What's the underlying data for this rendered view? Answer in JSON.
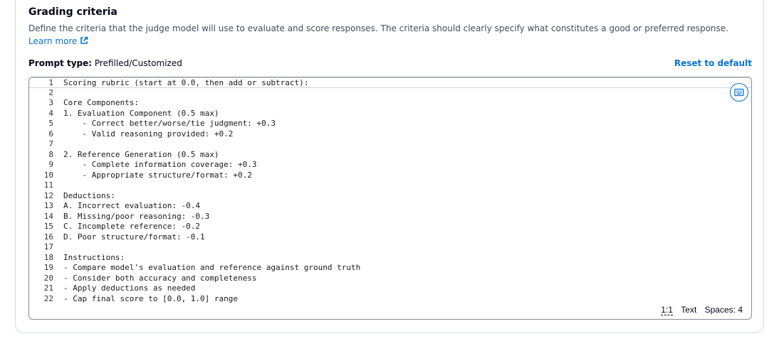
{
  "section": {
    "title": "Grading criteria",
    "description": "Define the criteria that the judge model will use to evaluate and score responses. The criteria should clearly specify what constitutes a good or preferred response.",
    "learn_more": "Learn more"
  },
  "prompt": {
    "type_label": "Prompt type:",
    "type_value": "Prefilled/Customized",
    "reset_label": "Reset to default"
  },
  "editor": {
    "lines": [
      "Scoring rubric (start at 0.0, then add or subtract):",
      "",
      "Core Components:",
      "1. Evaluation Component (0.5 max)",
      "    - Correct better/worse/tie judgment: +0.3",
      "    - Valid reasoning provided: +0.2",
      "",
      "2. Reference Generation (0.5 max)",
      "    - Complete information coverage: +0.3",
      "    - Appropriate structure/format: +0.2",
      "",
      "Deductions:",
      "A. Incorrect evaluation: -0.4",
      "B. Missing/poor reasoning: -0.3",
      "C. Incomplete reference: -0.2",
      "D. Poor structure/format: -0.1",
      "",
      "Instructions:",
      "- Compare model's evaluation and reference against ground truth",
      "- Consider both accuracy and completeness",
      "- Apply deductions as needed",
      "- Cap final score to [0.0, 1.0] range"
    ],
    "status": {
      "cursor": "1:1",
      "mode": "Text",
      "indent": "Spaces: 4"
    },
    "keyboard_icon": "keyboard-icon"
  },
  "colors": {
    "link": "#0972d3",
    "border": "#8c8c94"
  }
}
